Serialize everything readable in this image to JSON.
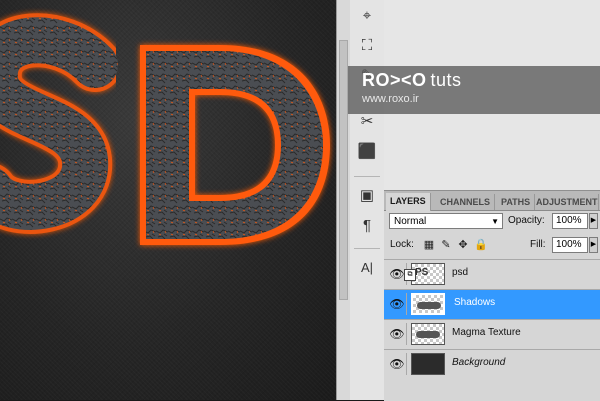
{
  "canvas": {
    "artwork_text": "PSD"
  },
  "tools": [
    {
      "icon": "stamp-icon",
      "glyph": "⌖"
    },
    {
      "icon": "history-brush-icon",
      "glyph": "⛶"
    },
    {
      "icon": "brush-icon",
      "glyph": "✎"
    },
    {
      "icon": "magic-wand-icon",
      "glyph": "✂"
    },
    {
      "icon": "3d-rotate-icon",
      "glyph": "⬛"
    },
    {
      "icon": "navigator-icon",
      "glyph": "▣"
    },
    {
      "icon": "paragraph-icon",
      "glyph": "¶"
    },
    {
      "icon": "character-icon",
      "glyph": "A|"
    }
  ],
  "layers_panel": {
    "tabs": [
      "LAYERS",
      "CHANNELS",
      "PATHS",
      "ADJUSTMENTS"
    ],
    "active_tab": "LAYERS",
    "blend_mode": "Normal",
    "opacity_label": "Opacity:",
    "opacity_value": "100%",
    "lock_label": "Lock:",
    "fill_label": "Fill:",
    "fill_value": "100%",
    "layers": [
      {
        "name": "psd",
        "selected": false,
        "italic": false,
        "thumb": "text"
      },
      {
        "name": "Shadows",
        "selected": true,
        "italic": false,
        "thumb": "blob"
      },
      {
        "name": "Magma Texture",
        "selected": false,
        "italic": false,
        "thumb": "blob"
      },
      {
        "name": "Background",
        "selected": false,
        "italic": true,
        "thumb": "dark"
      }
    ]
  },
  "watermark": {
    "brand": "RO><O",
    "brand_suffix": "tuts",
    "url": "www.roxo.ir"
  },
  "colors": {
    "selection": "#3399ff",
    "lava": "#ff5a0a",
    "rock": "#4a4d52"
  }
}
